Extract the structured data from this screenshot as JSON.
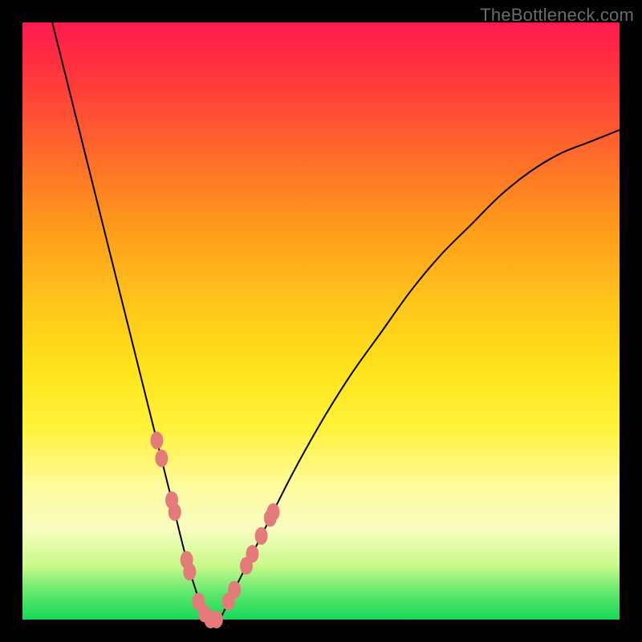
{
  "watermark": "TheBottleneck.com",
  "colors": {
    "background": "#000000",
    "gradient_top": "#ff1a4d",
    "gradient_bottom": "#16d858",
    "curve": "#000000",
    "marker": "#e47a7a"
  },
  "chart_data": {
    "type": "line",
    "title": "",
    "xlabel": "",
    "ylabel": "",
    "xlim": [
      0,
      1
    ],
    "ylim": [
      0,
      1
    ],
    "series": [
      {
        "name": "bottleneck-curve",
        "x": [
          0.05,
          0.1,
          0.15,
          0.2,
          0.225,
          0.25,
          0.275,
          0.3,
          0.31,
          0.32,
          0.33,
          0.35,
          0.4,
          0.45,
          0.5,
          0.55,
          0.6,
          0.65,
          0.7,
          0.75,
          0.8,
          0.85,
          0.9,
          0.95,
          1.0
        ],
        "y": [
          1.0,
          0.8,
          0.6,
          0.4,
          0.3,
          0.2,
          0.1,
          0.02,
          0.0,
          0.0,
          0.0,
          0.04,
          0.14,
          0.24,
          0.33,
          0.41,
          0.48,
          0.55,
          0.61,
          0.66,
          0.71,
          0.75,
          0.78,
          0.8,
          0.82
        ]
      }
    ],
    "markers": {
      "name": "highlight-points",
      "x": [
        0.225,
        0.233,
        0.25,
        0.255,
        0.275,
        0.28,
        0.295,
        0.305,
        0.315,
        0.325,
        0.345,
        0.355,
        0.375,
        0.385,
        0.4,
        0.415,
        0.42
      ],
      "y": [
        0.3,
        0.27,
        0.2,
        0.18,
        0.1,
        0.08,
        0.03,
        0.01,
        0.0,
        0.0,
        0.03,
        0.05,
        0.09,
        0.11,
        0.14,
        0.17,
        0.18
      ]
    }
  }
}
